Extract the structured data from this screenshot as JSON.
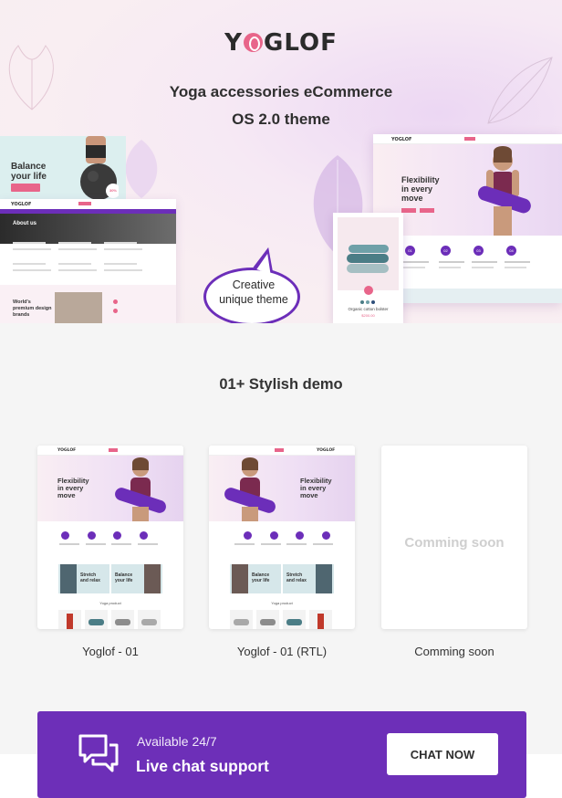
{
  "header": {
    "logo_text_left": "Y",
    "logo_text_right": "GLOF",
    "tagline_line1": "Yoga accessories eCommerce",
    "tagline_line2": "OS 2.0 theme"
  },
  "hero_mockups": {
    "balance_card": {
      "title_line1": "Balance",
      "title_line2": "your life",
      "discount": "30%\nOFF"
    },
    "about_page": {
      "logo": "YOGLOF",
      "banner_title": "About us",
      "brands_line1": "World's",
      "brands_line2": "premium design",
      "brands_line3": "brands"
    },
    "bubble": {
      "line1": "Creative",
      "line2": "unique theme"
    },
    "product_card": {
      "name": "Organic cotton bolster",
      "price": "$200.00"
    },
    "desktop": {
      "logo": "YOGLOF",
      "headline_line1": "Flexibility",
      "headline_line2": "in every",
      "headline_line3": "move",
      "features": [
        "01",
        "02",
        "03",
        "04"
      ]
    }
  },
  "demos": {
    "heading": "01+ Stylish demo",
    "items": [
      {
        "label": "Yoglof - 01",
        "headline_line1": "Flexibility",
        "headline_line2": "in every",
        "headline_line3": "move",
        "banner1_line1": "Stretch",
        "banner1_line2": "and relax",
        "banner2_line1": "Balance",
        "banner2_line2": "your life",
        "section_title": "Yoga product"
      },
      {
        "label": "Yoglof  - 01 (RTL)",
        "headline_line1": "Flexibility",
        "headline_line2": "in every",
        "headline_line3": "move",
        "banner1_line1": "Balance",
        "banner1_line2": "your life",
        "banner2_line1": "Stretch",
        "banner2_line2": "and relax",
        "section_title": "Yoga product"
      },
      {
        "label": "Comming soon",
        "placeholder": "Comming soon"
      }
    ]
  },
  "chat": {
    "small_text": "Available 24/7",
    "big_text": "Live chat support",
    "button_label": "CHAT NOW"
  },
  "colors": {
    "brand_purple": "#6d2fb8",
    "brand_pink": "#e8658a"
  }
}
